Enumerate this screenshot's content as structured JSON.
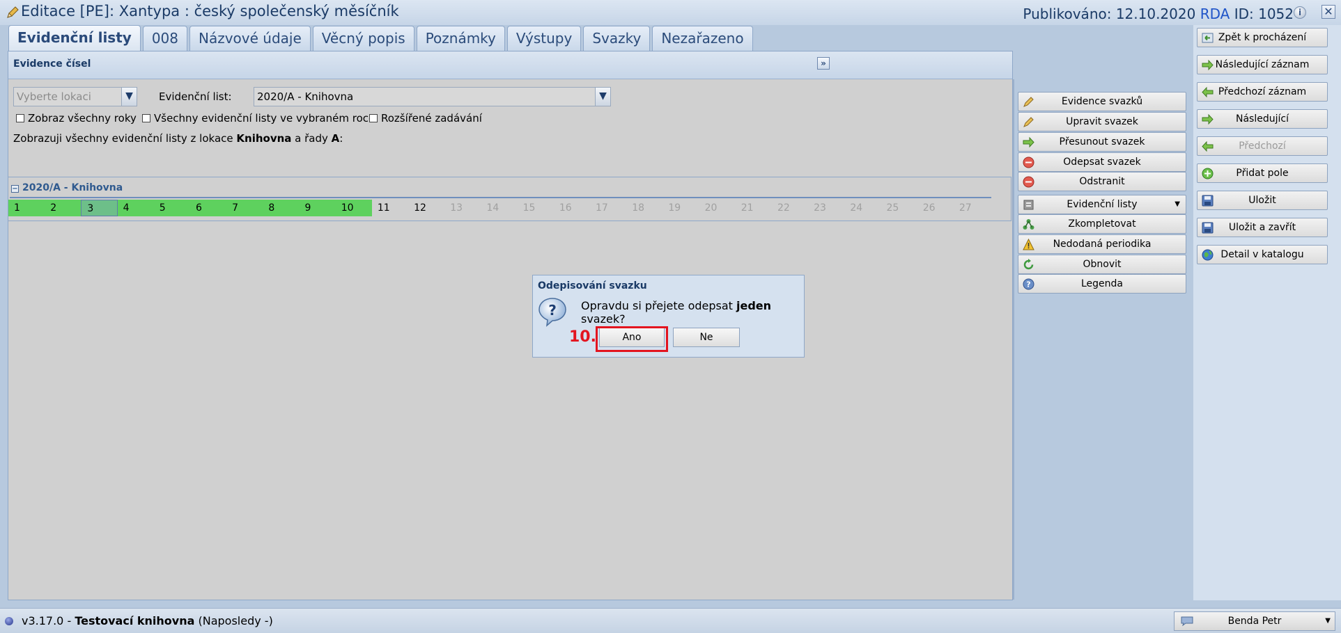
{
  "window": {
    "title": "Editace [PE]: Xantypa : český společenský měsíčník",
    "published_label": "Publikováno: 12.10.2020",
    "rda_label": "RDA",
    "id_label": "ID: 1052"
  },
  "tabs": [
    "Evidenční listy",
    "008",
    "Názvové údaje",
    "Věcný popis",
    "Poznámky",
    "Výstupy",
    "Svazky",
    "Nezařazeno"
  ],
  "panel": {
    "title": "Evidence čísel",
    "location_placeholder": "Vyberte lokaci",
    "list_label": "Evidenční list:",
    "list_value": "2020/A - Knihovna",
    "checkboxes": [
      "Zobraz všechny roky",
      "Všechny evidenční listy ve vybraném roce",
      "Rozšířené zadávání"
    ],
    "info_prefix": "Zobrazuji všechny evidenční listy z lokace ",
    "info_location": "Knihovna",
    "info_mid": " a řady ",
    "info_series": "A",
    "info_suffix": ":",
    "section_title": "2020/A - Knihovna",
    "numbers": [
      {
        "n": "1",
        "state": "green"
      },
      {
        "n": "2",
        "state": "green"
      },
      {
        "n": "3",
        "state": "selected"
      },
      {
        "n": "4",
        "state": "green"
      },
      {
        "n": "5",
        "state": "green"
      },
      {
        "n": "6",
        "state": "green"
      },
      {
        "n": "7",
        "state": "green"
      },
      {
        "n": "8",
        "state": "green"
      },
      {
        "n": "9",
        "state": "green"
      },
      {
        "n": "10",
        "state": "green"
      },
      {
        "n": "11",
        "state": "white"
      },
      {
        "n": "12",
        "state": "white"
      },
      {
        "n": "13",
        "state": "gray"
      },
      {
        "n": "14",
        "state": "gray"
      },
      {
        "n": "15",
        "state": "gray"
      },
      {
        "n": "16",
        "state": "gray"
      },
      {
        "n": "17",
        "state": "gray"
      },
      {
        "n": "18",
        "state": "gray"
      },
      {
        "n": "19",
        "state": "gray"
      },
      {
        "n": "20",
        "state": "gray"
      },
      {
        "n": "21",
        "state": "gray"
      },
      {
        "n": "22",
        "state": "gray"
      },
      {
        "n": "23",
        "state": "gray"
      },
      {
        "n": "24",
        "state": "gray"
      },
      {
        "n": "25",
        "state": "gray"
      },
      {
        "n": "26",
        "state": "gray"
      },
      {
        "n": "27",
        "state": "gray"
      }
    ]
  },
  "actions": [
    {
      "label": "Evidence svazků",
      "icon": "pencil-icon"
    },
    {
      "label": "Upravit svazek",
      "icon": "pencil-icon"
    },
    {
      "label": "Přesunout svazek",
      "icon": "arrow-right-icon"
    },
    {
      "label": "Odepsat svazek",
      "icon": "minus-circle-icon"
    },
    {
      "label": "Odstranit",
      "icon": "minus-circle-icon"
    },
    {
      "label": "Evidenční listy",
      "icon": "list-icon",
      "dropdown": "▼"
    },
    {
      "label": "Zkompletovat",
      "icon": "merge-icon"
    },
    {
      "label": "Nedodaná periodika",
      "icon": "warning-icon"
    },
    {
      "label": "Obnovit",
      "icon": "refresh-icon"
    },
    {
      "label": "Legenda",
      "icon": "help-icon"
    }
  ],
  "nav": [
    {
      "label": "Zpět k procházení",
      "icon": "back-icon"
    },
    {
      "label": "Následující záznam",
      "icon": "arrow-right-icon"
    },
    {
      "label": "Předchozí záznam",
      "icon": "arrow-left-icon"
    },
    {
      "label": "Následující",
      "icon": "arrow-right-icon"
    },
    {
      "label": "Předchozí",
      "icon": "arrow-left-icon",
      "disabled": true
    },
    {
      "label": "Přidat pole",
      "icon": "plus-circle-icon"
    },
    {
      "label": "Uložit",
      "icon": "save-icon"
    },
    {
      "label": "Uložit a zavřít",
      "icon": "save-icon"
    },
    {
      "label": "Detail v katalogu",
      "icon": "globe-icon"
    }
  ],
  "dialog": {
    "title": "Odepisování svazku",
    "msg_prefix": "Opravdu si přejete odepsat ",
    "msg_bold": "jeden",
    "msg_suffix": " svazek?",
    "yes": "Ano",
    "no": "Ne",
    "step_label": "10."
  },
  "status": {
    "version": "v3.17.0 - ",
    "library": "Testovací knihovna",
    "last": " (Naposledy -)",
    "user": "Benda Petr"
  },
  "colors": {
    "issue_received": "#5ed15e",
    "highlight": "#e3141f"
  }
}
